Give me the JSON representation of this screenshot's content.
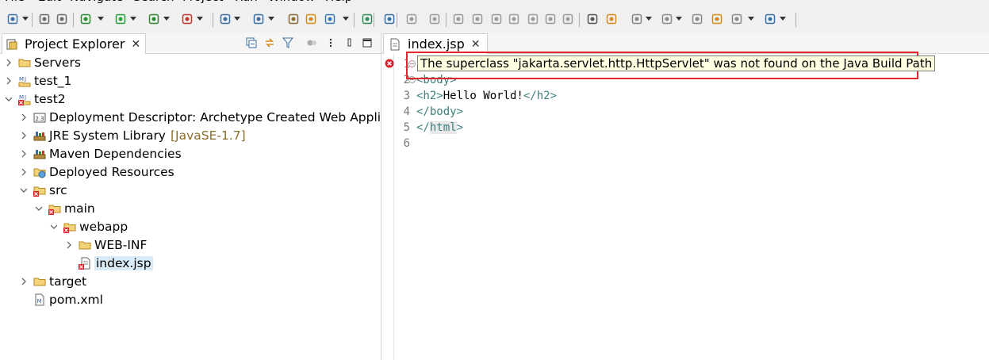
{
  "menu": [
    "File",
    "Edit",
    "Navigate",
    "Search",
    "Project",
    "Run",
    "Window",
    "Help"
  ],
  "toolbar_icons": [
    "new-icon",
    "save-icon",
    "print-icon",
    "debug-icon",
    "run-icon",
    "coverage-icon",
    "external-tools-icon",
    "new-server-icon",
    "new-java-project-icon",
    "open-type-icon",
    "search-icon",
    "globe-icon",
    "open-resource-icon",
    "task-icon",
    "skip-breakpoints-icon",
    "resume-icon",
    "suspend-icon",
    "terminate-icon",
    "disconnect-icon",
    "step-into-icon",
    "step-over-icon",
    "step-return-icon",
    "drop-to-frame-icon",
    "toggle-word-wrap-icon",
    "show-whitespace-icon",
    "next-annotation-icon",
    "previous-annotation-icon",
    "last-edit-icon",
    "back-icon",
    "forward-icon",
    "pin-icon"
  ],
  "explorer": {
    "title": "Project Explorer",
    "close_label": "✕",
    "tree": [
      {
        "label": "Servers",
        "icon": "folder-icon",
        "twisty": "collapsed",
        "level": 0
      },
      {
        "label": "test_1",
        "icon": "maven-project-icon",
        "twisty": "collapsed",
        "level": 0
      },
      {
        "label": "test2",
        "icon": "maven-project-error-icon",
        "twisty": "expanded",
        "level": 0
      },
      {
        "label": "Deployment Descriptor: Archetype Created Web Application",
        "icon": "deployment-descriptor-icon",
        "twisty": "collapsed",
        "level": 1
      },
      {
        "label": "JRE System Library",
        "suffix": "[JavaSE-1.7]",
        "icon": "library-icon",
        "twisty": "collapsed",
        "level": 1
      },
      {
        "label": "Maven Dependencies",
        "icon": "library-icon",
        "twisty": "collapsed",
        "level": 1
      },
      {
        "label": "Deployed Resources",
        "icon": "deployed-resources-icon",
        "twisty": "collapsed",
        "level": 1
      },
      {
        "label": "src",
        "icon": "folder-error-icon",
        "twisty": "expanded",
        "level": 1
      },
      {
        "label": "main",
        "icon": "folder-error-icon",
        "twisty": "expanded",
        "level": 2
      },
      {
        "label": "webapp",
        "icon": "folder-error-icon",
        "twisty": "expanded",
        "level": 3
      },
      {
        "label": "WEB-INF",
        "icon": "folder-icon",
        "twisty": "collapsed",
        "level": 4
      },
      {
        "label": "index.jsp",
        "icon": "jsp-file-error-icon",
        "twisty": "none",
        "level": 4,
        "selected": true
      },
      {
        "label": "target",
        "icon": "folder-icon",
        "twisty": "collapsed",
        "level": 1
      },
      {
        "label": "pom.xml",
        "icon": "pom-file-icon",
        "twisty": "none",
        "level": 1
      }
    ]
  },
  "editor": {
    "tab_label": "index.jsp",
    "close_label": "✕",
    "lines": [
      {
        "num": "1",
        "fold": true
      },
      {
        "num": "2",
        "fold": true,
        "parts": [
          {
            "t": "<body>",
            "c": "tag"
          }
        ]
      },
      {
        "num": "3",
        "fold": false,
        "parts": [
          {
            "t": "<h2>",
            "c": "tag"
          },
          {
            "t": "Hello World!",
            "c": "txt"
          },
          {
            "t": "</h2>",
            "c": "tag"
          }
        ]
      },
      {
        "num": "4",
        "fold": false,
        "parts": [
          {
            "t": "</body>",
            "c": "tag"
          }
        ]
      },
      {
        "num": "5",
        "fold": false,
        "parts": [
          {
            "t": "</",
            "c": "tag"
          },
          {
            "t": "html",
            "c": "tag-hl"
          },
          {
            "t": ">",
            "c": "tag"
          }
        ]
      },
      {
        "num": "6",
        "fold": false,
        "parts": []
      }
    ],
    "tooltip": "The superclass \"jakarta.servlet.http.HttpServlet\" was not found on the Java Build Path"
  },
  "colors": {
    "error_red": "#d9232e",
    "highlight_box": "#e0262e",
    "tooltip_bg": "#ffffe1",
    "selection_bg": "#d9ebf9",
    "tag_color": "#3f7f7f"
  }
}
